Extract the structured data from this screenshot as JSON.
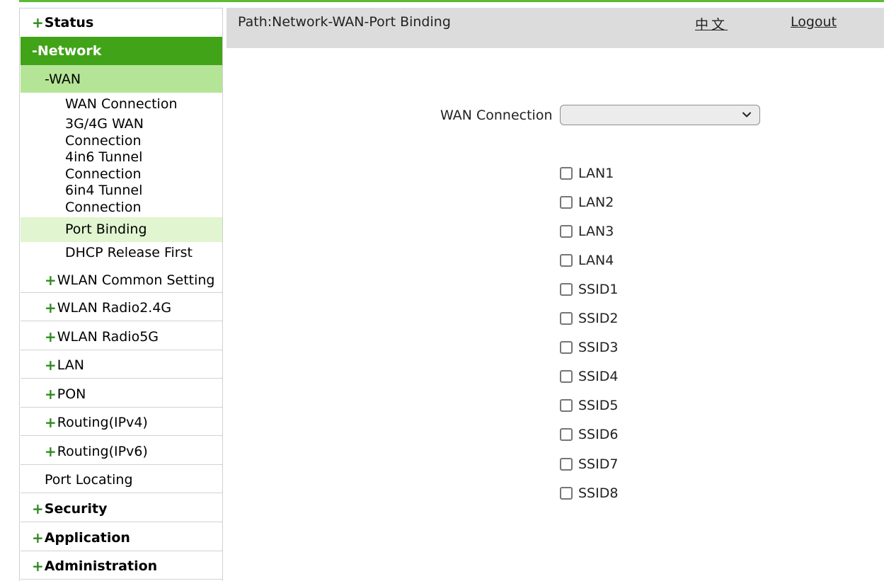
{
  "header": {
    "breadcrumb": "Path:Network-WAN-Port Binding",
    "language_link": "中文",
    "logout_link": "Logout"
  },
  "sidebar": {
    "status": "Status",
    "network": "-Network",
    "wan": "-WAN",
    "wan_items": {
      "wan_connection": "WAN Connection",
      "g3g4_connection": "3G/4G WAN Connection",
      "tunnel_4in6": "4in6 Tunnel Connection",
      "tunnel_6in4": "6in4 Tunnel Connection",
      "port_binding": "Port Binding",
      "dhcp_release_first": "DHCP Release First"
    },
    "network_items": {
      "wlan_common": "WLAN Common Setting",
      "wlan_24": "WLAN Radio2.4G",
      "wlan_5": "WLAN Radio5G",
      "lan": "LAN",
      "pon": "PON",
      "routing_v4": "Routing(IPv4)",
      "routing_v6": "Routing(IPv6)",
      "port_locating": "Port Locating"
    },
    "security": "Security",
    "application": "Application",
    "administration": "Administration",
    "expand_symbol": "+"
  },
  "form": {
    "wan_connection_label": "WAN Connection",
    "wan_connection_value": "",
    "ports": [
      "LAN1",
      "LAN2",
      "LAN3",
      "LAN4",
      "SSID1",
      "SSID2",
      "SSID3",
      "SSID4",
      "SSID5",
      "SSID6",
      "SSID7",
      "SSID8"
    ],
    "ports_checked": [
      false,
      false,
      false,
      false,
      false,
      false,
      false,
      false,
      false,
      false,
      false,
      false
    ]
  },
  "colors": {
    "accent_green": "#41a317",
    "light_green": "#b4e597",
    "selected_green": "#e0f5d0",
    "plus_green": "#2e8b1e",
    "header_gray": "#dcdcdc"
  }
}
